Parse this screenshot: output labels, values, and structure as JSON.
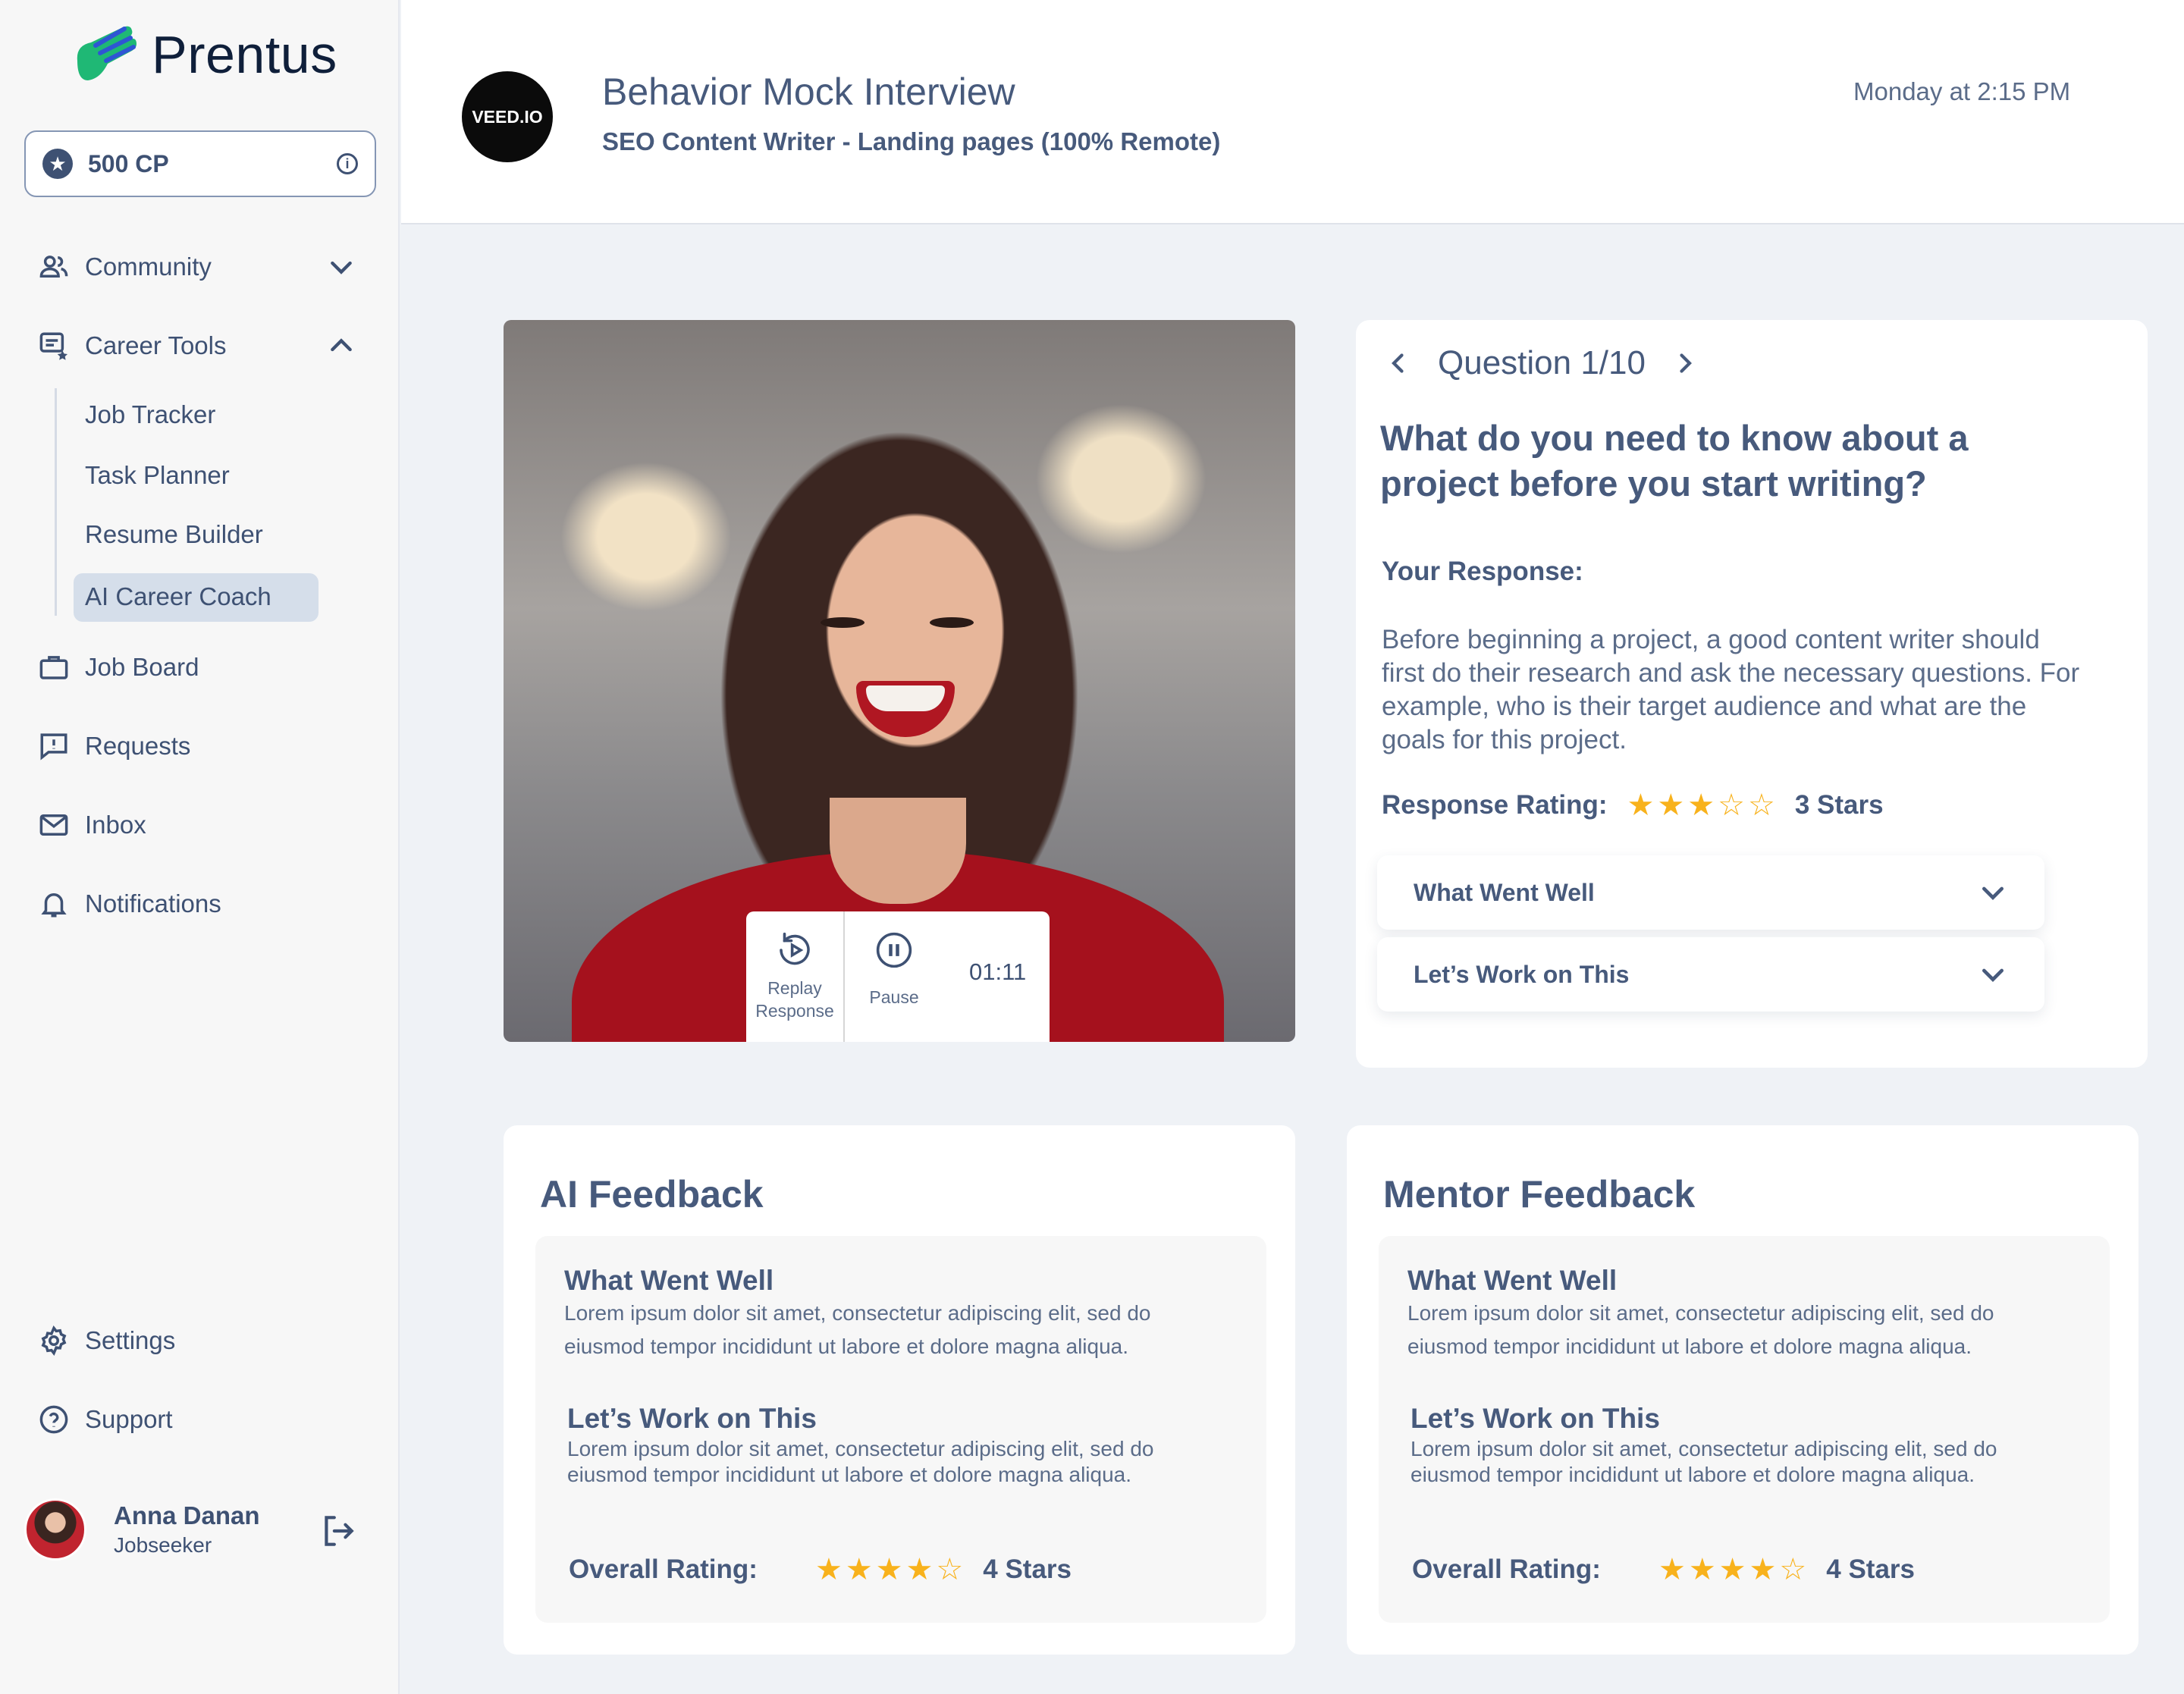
{
  "brand": {
    "name": "Prentus",
    "accent": "#22c07a"
  },
  "points": {
    "label": "500 CP"
  },
  "nav": {
    "community": "Community",
    "career_tools": "Career Tools",
    "sub": [
      "Job Tracker",
      "Task Planner",
      "Resume Builder",
      "AI Career Coach"
    ],
    "job_board": "Job Board",
    "requests": "Requests",
    "inbox": "Inbox",
    "notifications": "Notifications",
    "settings": "Settings",
    "support": "Support"
  },
  "user": {
    "name": "Anna Danan",
    "role": "Jobseeker"
  },
  "header": {
    "company_logo": "VEED.IO",
    "title": "Behavior Mock Interview",
    "subtitle": "SEO Content Writer - Landing pages (100% Remote)",
    "time": "Monday at 2:15 PM"
  },
  "video": {
    "replay_line1": "Replay",
    "replay_line2": "Response",
    "pause": "Pause",
    "timer": "01:11"
  },
  "question": {
    "counter": "Question 1/10",
    "text": "What do you need to know about a project before you start writing?",
    "response_label": "Your Response:",
    "response_text": "Before beginning a project, a good content writer should first do their research and ask the necessary questions. For example, who is their target audience and what are the goals for this project.",
    "rating_label": "Response Rating:",
    "rating_value": 3,
    "rating_text": "3 Stars",
    "accordion": [
      "What Went Well",
      "Let’s Work on This"
    ]
  },
  "ai_feedback": {
    "title": "AI Feedback",
    "went_well_title": "What Went Well",
    "went_well_text": "Lorem ipsum dolor sit amet, consectetur adipiscing elit, sed do eiusmod tempor incididunt ut labore et dolore magna aliqua.",
    "work_on_title": "Let’s Work on This",
    "work_on_text": "Lorem ipsum dolor sit amet, consectetur adipiscing elit, sed do eiusmod tempor incididunt ut labore et dolore magna aliqua.",
    "rating_label": "Overall Rating:",
    "rating_value": 4,
    "rating_text": "4 Stars"
  },
  "mentor_feedback": {
    "title": "Mentor Feedback",
    "went_well_title": "What Went Well",
    "went_well_text": "Lorem ipsum dolor sit amet, consectetur adipiscing elit, sed do eiusmod tempor incididunt ut labore et dolore magna aliqua.",
    "work_on_title": "Let’s Work on This",
    "work_on_text": "Lorem ipsum dolor sit amet, consectetur adipiscing elit, sed do eiusmod tempor incididunt ut labore et dolore magna aliqua.",
    "rating_label": "Overall Rating:",
    "rating_value": 4,
    "rating_text": "4 Stars"
  },
  "colors": {
    "text": "#475a7c",
    "star": "#f8b21c",
    "active_bg": "#d5deea"
  }
}
